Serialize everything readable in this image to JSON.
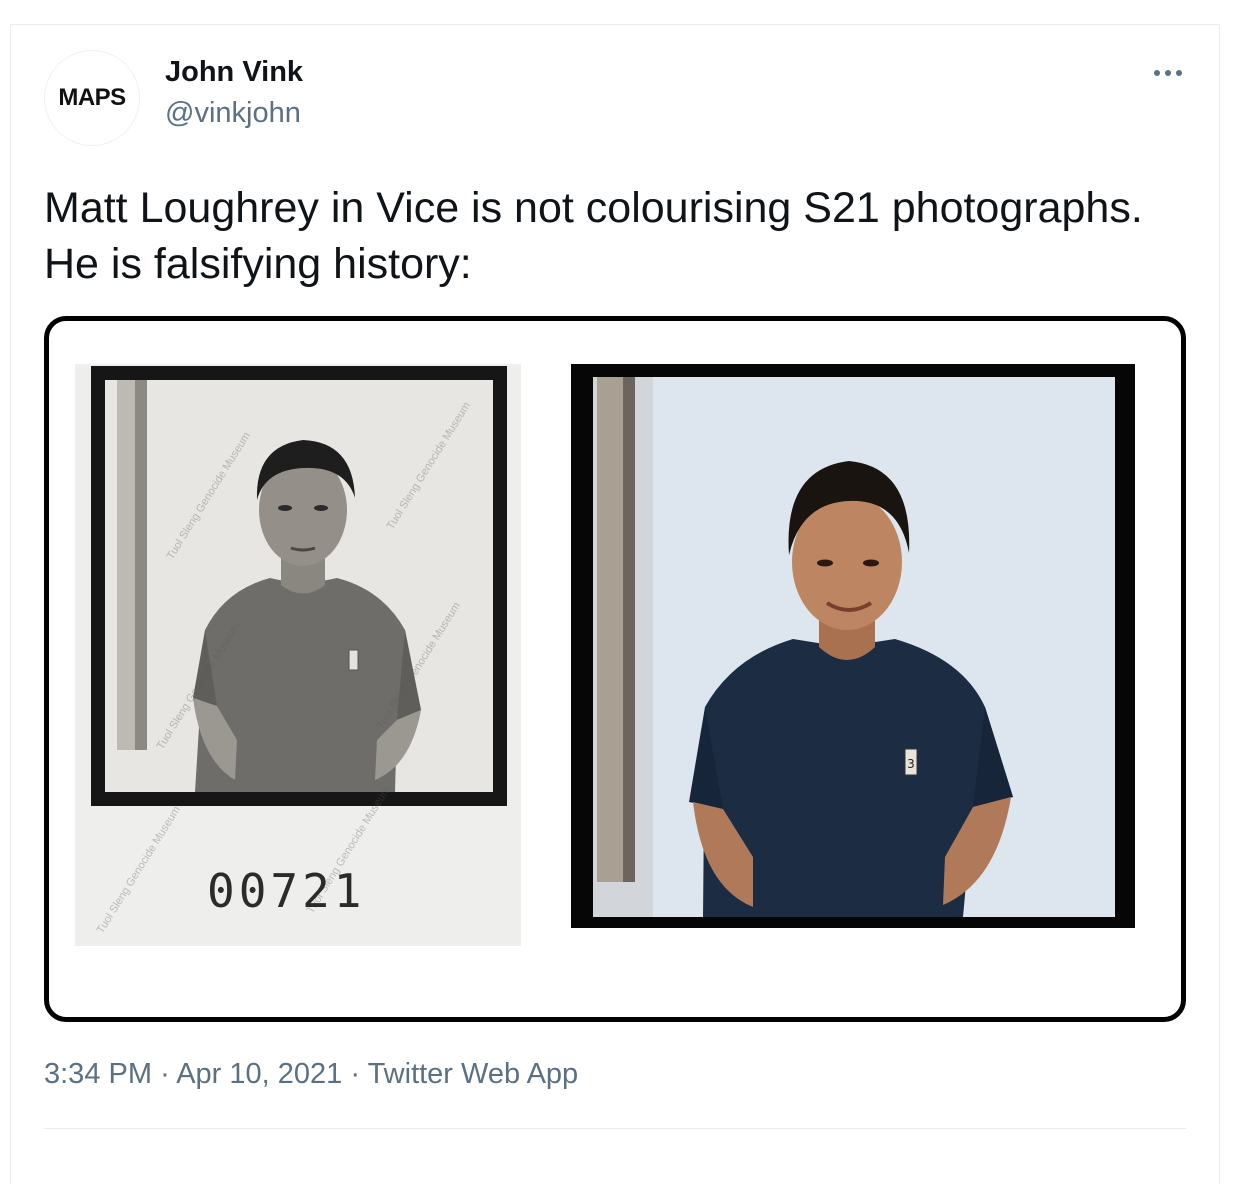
{
  "author": {
    "avatar_text": "MAPS",
    "display_name": "John Vink",
    "handle": "@vinkjohn"
  },
  "tweet": {
    "text": "Matt Loughrey in Vice is not colourising S21 photographs.\nHe is falsifying history:"
  },
  "media": {
    "left_photo": {
      "serial_number": "00721",
      "watermark_text": "Tuol Sleng Genocide Museum"
    },
    "right_photo": {
      "tag_number": "3"
    }
  },
  "meta": {
    "time": "3:34 PM",
    "separator": "·",
    "date": "Apr 10, 2021",
    "source": "Twitter Web App"
  },
  "icons": {
    "more": "more-horizontal-icon"
  }
}
